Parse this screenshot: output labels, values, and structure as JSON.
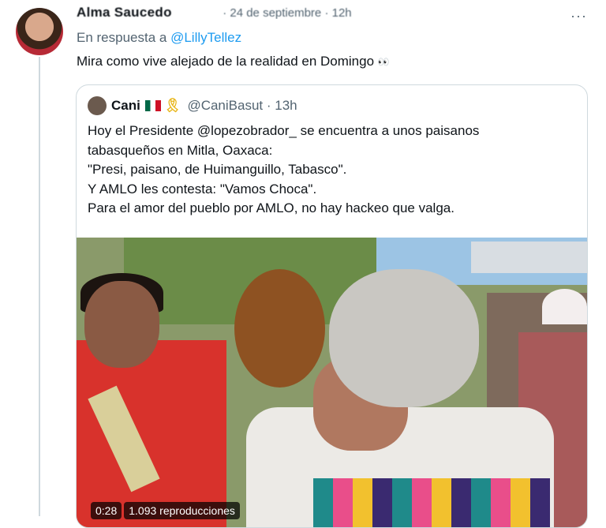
{
  "tweet": {
    "author_name": "Alma Saucedo",
    "author_meta": "· 24 de septiembre · 12h",
    "more_label": "···",
    "replying_prefix": "En respuesta a",
    "replying_mention": "@LillyTellez",
    "text": "Mira como vive alejado de la realidad en Domingo",
    "emoji": "👀"
  },
  "quote": {
    "name": "Cani",
    "ribbon": "🎗",
    "handle_time": "@CaniBasut · 13h",
    "lines": [
      "Hoy el Presidente @lopezobrador_ se encuentra a unos paisanos",
      "tabasqueños en Mitla, Oaxaca:",
      "\"Presi, paisano, de Huimanguillo, Tabasco\".",
      "Y AMLO les contesta: \"Vamos Choca\".",
      "Para el amor del pueblo por AMLO, no hay hackeo que valga."
    ]
  },
  "video": {
    "duration": "0:28",
    "views": "1.093 reproducciones"
  }
}
